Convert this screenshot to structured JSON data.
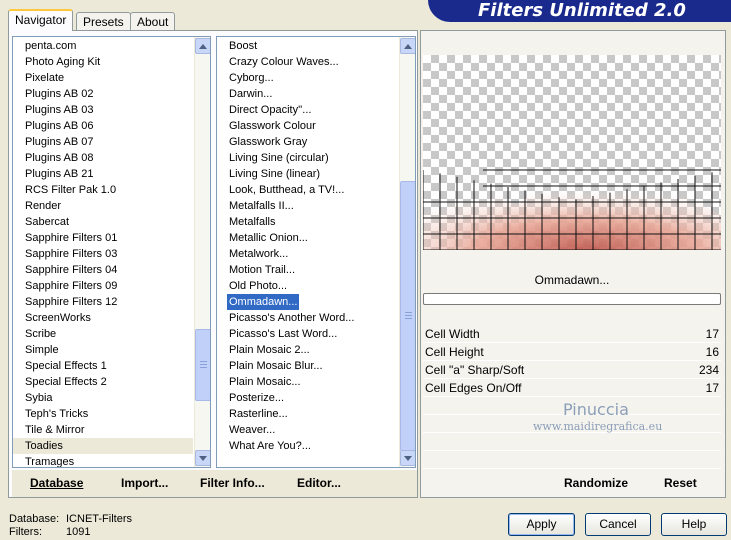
{
  "header": {
    "title": "Filters Unlimited 2.0"
  },
  "tabs": [
    {
      "label": "Navigator"
    },
    {
      "label": "Presets"
    },
    {
      "label": "About"
    }
  ],
  "categories": {
    "items": [
      "penta.com",
      "Photo Aging Kit",
      "Pixelate",
      "Plugins AB 02",
      "Plugins AB 03",
      "Plugins AB 06",
      "Plugins AB 07",
      "Plugins AB 08",
      "Plugins AB 21",
      "RCS Filter Pak 1.0",
      "Render",
      "Sabercat",
      "Sapphire Filters 01",
      "Sapphire Filters 03",
      "Sapphire Filters 04",
      "Sapphire Filters 09",
      "Sapphire Filters 12",
      "ScreenWorks",
      "Scribe",
      "Simple",
      "Special Effects 1",
      "Special Effects 2",
      "Sybia",
      "Teph's Tricks",
      "Tile & Mirror",
      "Toadies",
      "Tramages"
    ],
    "selected": "Toadies"
  },
  "filters": {
    "items": [
      "Boost",
      "Crazy Colour Waves...",
      "Cyborg...",
      "Darwin...",
      "Direct Opacity''...",
      "Glasswork Colour",
      "Glasswork Gray",
      "Living Sine (circular)",
      "Living Sine (linear)",
      "Look, Butthead, a TV!...",
      "Metalfalls II...",
      "Metalfalls",
      "Metallic Onion...",
      "Metalwork...",
      "Motion Trail...",
      "Old Photo...",
      "Ommadawn...",
      "Picasso's Another Word...",
      "Picasso's Last Word...",
      "Plain Mosaic 2...",
      "Plain Mosaic Blur...",
      "Plain Mosaic...",
      "Posterize...",
      "Rasterline...",
      "Weaver...",
      "What Are You?..."
    ],
    "selected": "Ommadawn..."
  },
  "left_actions": {
    "database": "Database",
    "import": "Import...",
    "filter_info": "Filter Info...",
    "editor": "Editor..."
  },
  "preview": {
    "filter_name": "Ommadawn...",
    "progress": 0
  },
  "params": [
    {
      "name": "Cell Width",
      "value": "17"
    },
    {
      "name": "Cell Height",
      "value": "16"
    },
    {
      "name": "Cell \"a\" Sharp/Soft",
      "value": "234"
    },
    {
      "name": "Cell Edges On/Off",
      "value": "17"
    }
  ],
  "watermark": {
    "line1": "Pinuccia",
    "line2": "www.maidiregrafica.eu"
  },
  "right_actions": {
    "randomize": "Randomize",
    "reset": "Reset"
  },
  "status": {
    "database_label": "Database:",
    "database_value": "ICNET-Filters",
    "filters_label": "Filters:",
    "filters_value": "1091"
  },
  "buttons": {
    "apply": "Apply",
    "cancel": "Cancel",
    "help": "Help"
  },
  "colors": {
    "banner": "#1a2a8c",
    "selection": "#316ac5",
    "face": "#ece9d8"
  }
}
